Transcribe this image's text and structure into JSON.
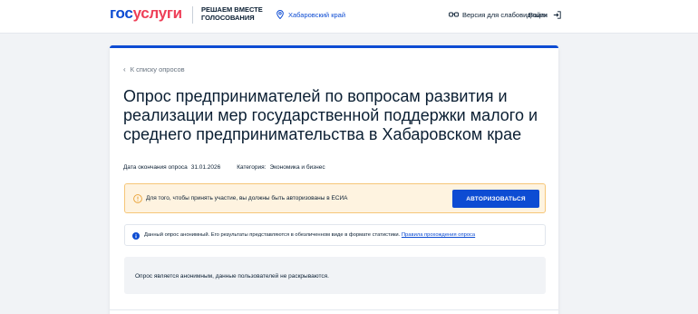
{
  "header": {
    "logo_part1": "гос",
    "logo_part2": "услуги",
    "slogan_line1": "РЕШАЕМ ВМЕСТЕ",
    "slogan_line2": "ГОЛОСОВАНИЯ",
    "region": "Хабаровский край",
    "vision_label": "Версия для слабовидящих",
    "login_label": "Войти"
  },
  "survey": {
    "back_label": "К списку опросов",
    "title": "Опрос предпринимателей по вопросам развития и реализации мер государственной поддержки малого и среднего предпринимательства в Хабаровском крае",
    "end_date_label": "Дата окончания опроса",
    "end_date": "31.01.2026",
    "category_label": "Категория:",
    "category": "Экономика и бизнес"
  },
  "auth_banner": {
    "text": "Для того, чтобы принять участие, вы должны быть авторизованы в ЕСИА",
    "button": "АВТОРИЗОВАТЬСЯ"
  },
  "info_banner": {
    "text": "Данный опрос анонимный. Его результаты представляются в обезличенном виде в формате статистики.",
    "link": "Правила прохождения опроса"
  },
  "anon_notice": {
    "text": "Опрос является анонимным, данные пользователей не раскрываются."
  },
  "colors": {
    "brand_blue": "#0d4cd3",
    "brand_red": "#ee3f58",
    "warning_bg": "#fef3e0",
    "warning_border": "#f6c678",
    "page_bg": "#f1f3f6"
  },
  "icons": [
    "location-pin-icon",
    "glasses-icon",
    "login-arrow-icon",
    "warning-icon",
    "info-icon",
    "chevron-left-icon"
  ]
}
